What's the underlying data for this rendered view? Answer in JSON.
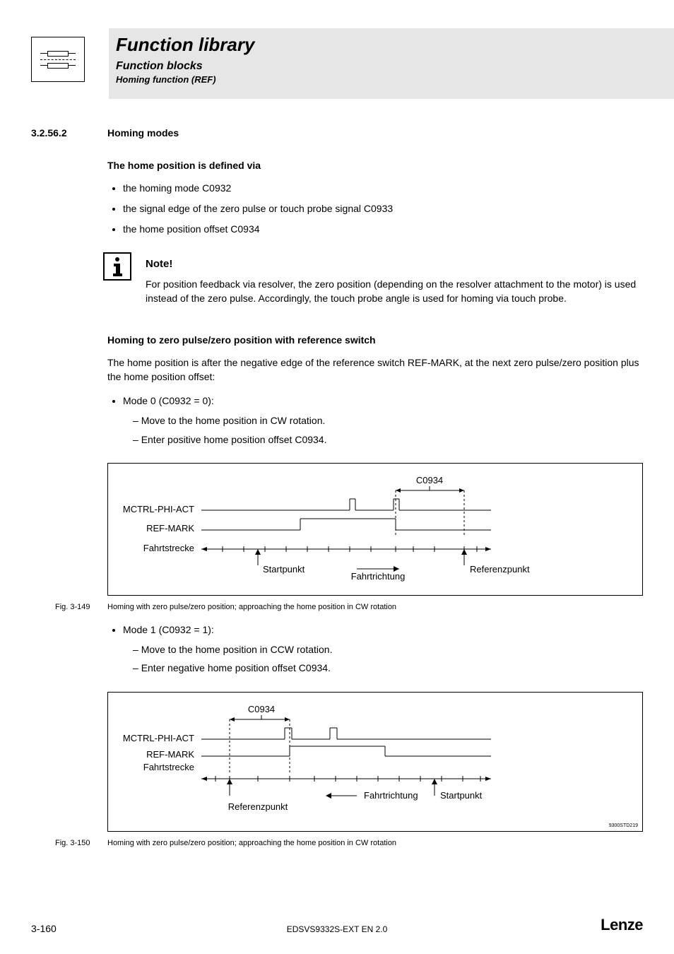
{
  "header": {
    "title": "Function library",
    "subtitle": "Function blocks",
    "subsubtitle": "Homing function (REF)"
  },
  "section": {
    "number": "3.2.56.2",
    "title": "Homing modes"
  },
  "intro": {
    "heading": "The home position is defined via",
    "bullets": [
      "the homing mode C0932",
      "the signal edge of the zero pulse or touch probe signal C0933",
      "the home position offset C0934"
    ]
  },
  "note": {
    "title": "Note!",
    "body": "For position feedback via resolver, the zero position (depending on the resolver attachment to the motor) is used instead of the zero pulse. Accordingly, the touch probe angle is used for homing via touch probe."
  },
  "zeropulse": {
    "heading": "Homing to zero pulse/zero position with reference switch",
    "para": "The home position is after the negative edge of the reference switch REF-MARK, at the next zero pulse/zero position plus the home position offset:"
  },
  "mode0": {
    "label": "Mode 0 (C0932 = 0):",
    "sub1": "Move to the home position in CW rotation.",
    "sub2": "Enter positive home position offset C0934."
  },
  "fig1": {
    "c0934": "C0934",
    "mctrl": "MCTRL-PHI-ACT",
    "refmark": "REF-MARK",
    "fahrtstrecke": "Fahrtstrecke",
    "startpunkt": "Startpunkt",
    "fahrtrichtung": "Fahrtrichtung",
    "referenzpunkt": "Referenzpunkt",
    "num": "Fig. 3-149",
    "caption": "Homing with zero pulse/zero position; approaching the home position in CW rotation"
  },
  "mode1": {
    "label": "Mode 1 (C0932 = 1):",
    "sub1": "Move to the home position in CCW rotation.",
    "sub2": "Enter negative home position offset C0934."
  },
  "fig2": {
    "c0934": "C0934",
    "mctrl": "MCTRL-PHI-ACT",
    "refmark": "REF-MARK",
    "fahrtstrecke": "Fahrtstrecke",
    "startpunkt": "Startpunkt",
    "fahrtrichtung": "Fahrtrichtung",
    "referenzpunkt": "Referenzpunkt",
    "code": "9300STD219",
    "num": "Fig. 3-150",
    "caption": "Homing with zero pulse/zero position; approaching the home position in CW rotation"
  },
  "footer": {
    "left": "3-160",
    "center": "EDSVS9332S-EXT EN 2.0",
    "right": "Lenze"
  }
}
